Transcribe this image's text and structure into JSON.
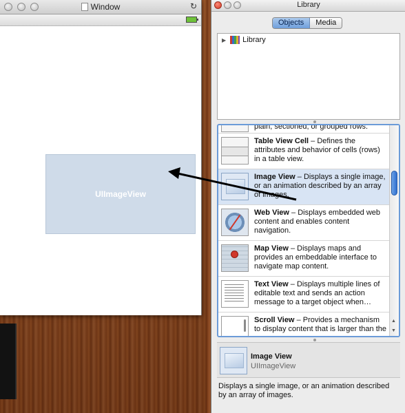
{
  "window": {
    "title": "Window",
    "image_view_label": "UIImageView"
  },
  "library": {
    "title": "Library",
    "tabs": [
      "Objects",
      "Media"
    ],
    "active_tab": "Objects",
    "tree": {
      "root_label": "Library"
    },
    "items": [
      {
        "name": "",
        "description": "plain, sectioned, or grouped rows.",
        "icon": "table-view-icon"
      },
      {
        "name": "Table View Cell",
        "description": "– Defines the attributes and behavior of cells (rows) in a table view.",
        "icon": "table-view-cell-icon"
      },
      {
        "name": "Image View",
        "description": "– Displays a single image, or an animation described by an array of images.",
        "icon": "image-view-icon"
      },
      {
        "name": "Web View",
        "description": "– Displays embedded web content and enables content navigation.",
        "icon": "web-view-icon"
      },
      {
        "name": "Map View",
        "description": "– Displays maps and provides an embeddable interface to navigate map content.",
        "icon": "map-view-icon"
      },
      {
        "name": "Text View",
        "description": "– Displays multiple lines of editable text and sends an action message to a target object when…",
        "icon": "text-view-icon"
      },
      {
        "name": "Scroll View",
        "description": "– Provides a mechanism to display content that is larger than the",
        "icon": "scroll-view-icon"
      }
    ],
    "detail": {
      "name": "Image View",
      "class_name": "UIImageView",
      "description": "Displays a single image, or an animation described by an array of images."
    }
  },
  "colors": {
    "selection": "#d8e4f4",
    "focus_ring": "#6b9bd8",
    "image_view_fill": "#cfdbe9"
  }
}
